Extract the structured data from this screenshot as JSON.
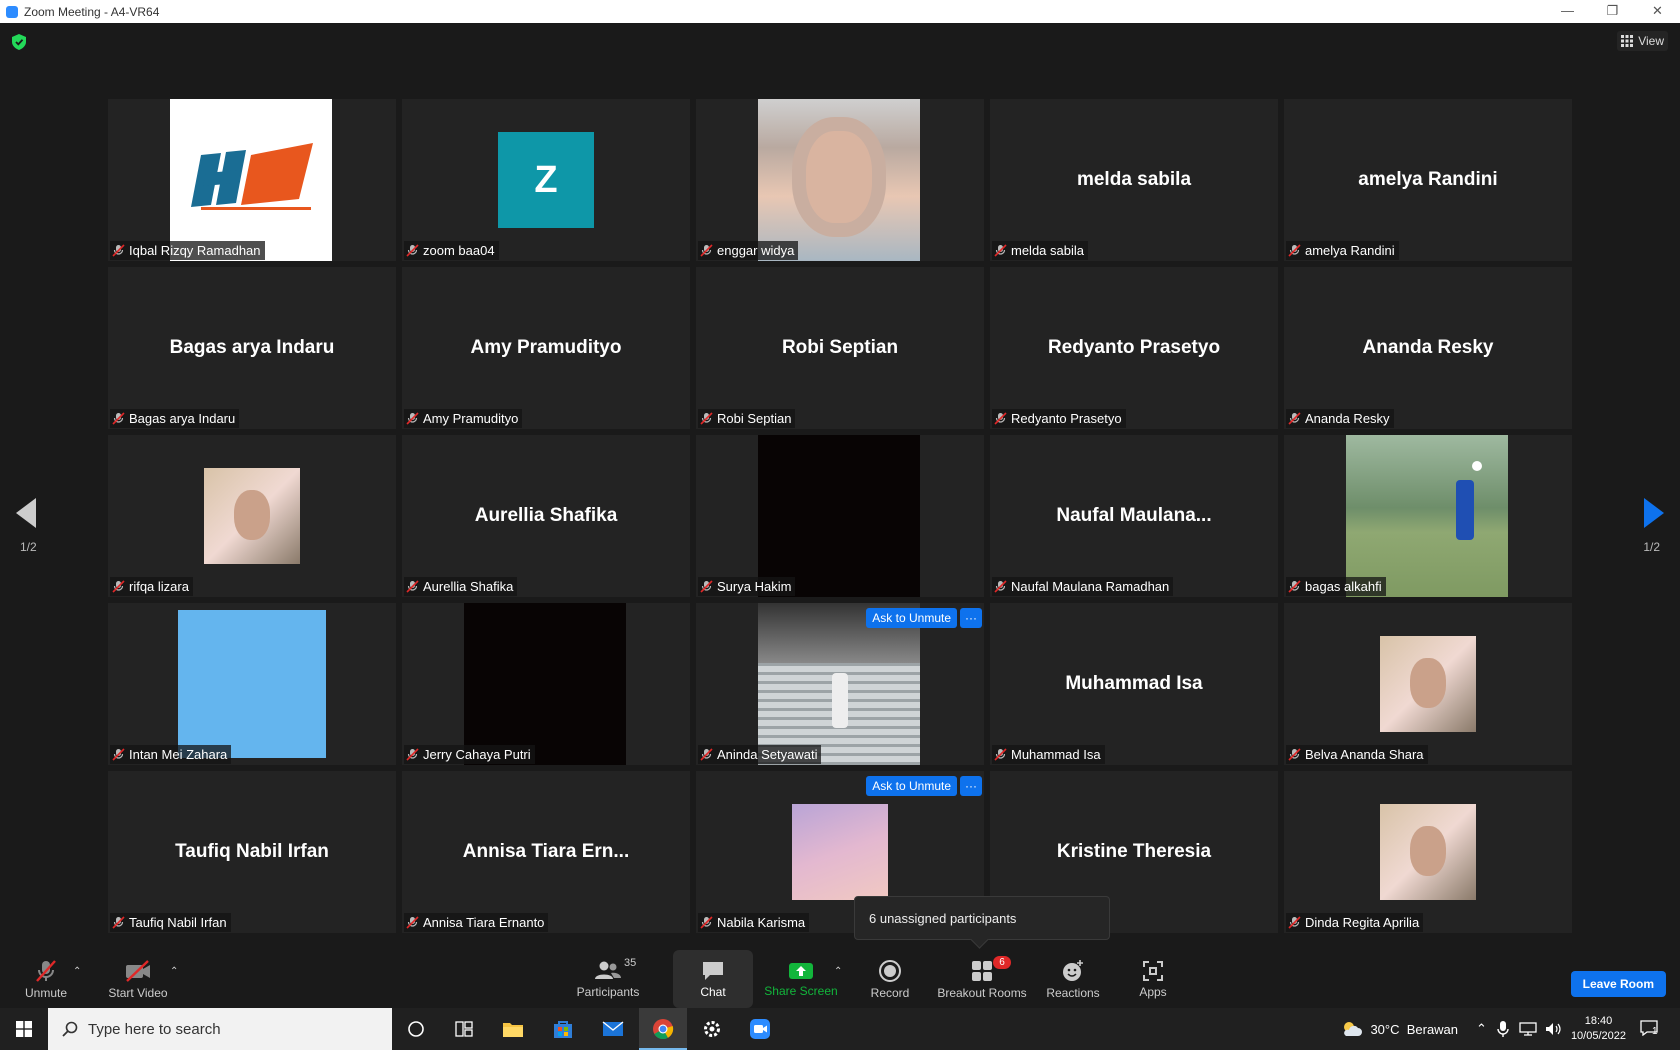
{
  "window": {
    "title": "Zoom Meeting - A4-VR64",
    "controls": [
      "minimize-icon",
      "restore-icon",
      "close-icon"
    ]
  },
  "topbar": {
    "view_label": "View"
  },
  "tiles": [
    {
      "big": "",
      "label": "Iqbal Rizqy Ramadhan",
      "media": "logo"
    },
    {
      "big": "",
      "label": "zoom baa04",
      "media": "letter",
      "letter": "Z",
      "color": "#0e97a8"
    },
    {
      "big": "",
      "label": "enggar widya",
      "media": "photo"
    },
    {
      "big": "melda sabila",
      "label": "melda sabila"
    },
    {
      "big": "amelya Randini",
      "label": "amelya Randini"
    },
    {
      "big": "Bagas arya Indaru",
      "label": "Bagas arya Indaru"
    },
    {
      "big": "Amy Pramudityo",
      "label": "Amy Pramudityo"
    },
    {
      "big": "Robi Septian",
      "label": "Robi Septian"
    },
    {
      "big": "Redyanto Prasetyo",
      "label": "Redyanto Prasetyo"
    },
    {
      "big": "Ananda Resky",
      "label": "Ananda Resky"
    },
    {
      "big": "",
      "label": "rifqa lizara",
      "media": "photo-small"
    },
    {
      "big": "Aurellia Shafika",
      "label": "Aurellia Shafika"
    },
    {
      "big": "",
      "label": "Surya Hakim",
      "media": "black"
    },
    {
      "big": "Naufal  Maulana...",
      "label": "Naufal Maulana Ramadhan"
    },
    {
      "big": "",
      "label": "bagas alkahfi",
      "media": "photo-field"
    },
    {
      "big": "",
      "label": "Intan Mei Zahara",
      "media": "lightblue"
    },
    {
      "big": "",
      "label": "Jerry Cahaya Putri",
      "media": "black"
    },
    {
      "big": "",
      "label": "Aninda Setyawati",
      "media": "photo-stairs",
      "ask": true
    },
    {
      "big": "Muhammad Isa",
      "label": "Muhammad Isa"
    },
    {
      "big": "",
      "label": "Belva Ananda Shara",
      "media": "photo-small"
    },
    {
      "big": "Taufiq Nabil Irfan",
      "label": "Taufiq Nabil Irfan"
    },
    {
      "big": "Annisa  Tiara  Ern...",
      "label": "Annisa Tiara Ernanto"
    },
    {
      "big": "",
      "label": "Nabila Karisma",
      "media": "photo-sky",
      "ask": true
    },
    {
      "big": "Kristine Theresia",
      "label": ""
    },
    {
      "big": "",
      "label": "Dinda Regita Aprilia",
      "media": "photo-small"
    }
  ],
  "ask_to_unmute": "Ask to Unmute",
  "more": "···",
  "paging": {
    "left": "1/2",
    "right": "1/2"
  },
  "tooltip": "6 unassigned participants",
  "toolbar": {
    "unmute": "Unmute",
    "start_video": "Start Video",
    "participants": "Participants",
    "participants_count": "35",
    "chat": "Chat",
    "share_screen": "Share Screen",
    "record": "Record",
    "breakout_rooms": "Breakout Rooms",
    "breakout_badge": "6",
    "reactions": "Reactions",
    "apps": "Apps",
    "leave_room": "Leave Room"
  },
  "taskbar": {
    "search_placeholder": "Type here to search",
    "weather": "30°C  Berawan",
    "time": "18:40",
    "date": "10/05/2022",
    "notifications": "1"
  },
  "colors": {
    "accent": "#0e72ed",
    "share_green": "#12b53b",
    "badge_red": "#e02828"
  }
}
